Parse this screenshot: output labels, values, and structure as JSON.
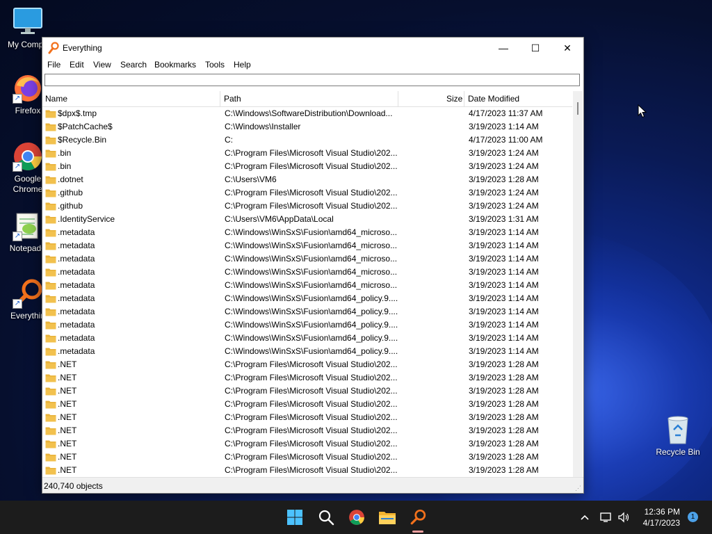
{
  "desktop": {
    "icons": [
      {
        "label": "My Compu",
        "icon": "monitor-icon"
      },
      {
        "label": "Firefox",
        "icon": "firefox-icon"
      },
      {
        "label": "Google Chrome",
        "icon": "chrome-icon"
      },
      {
        "label": "Notepad+",
        "icon": "notepad-plus-plus-icon"
      },
      {
        "label": "Everythin",
        "icon": "everything-icon"
      },
      {
        "label": "Recycle Bin",
        "icon": "recycle-bin-icon"
      }
    ]
  },
  "window": {
    "title": "Everything",
    "controls": {
      "minimize": "—",
      "maximize": "☐",
      "close": "✕"
    },
    "menu": [
      "File",
      "Edit",
      "View",
      "Search",
      "Bookmarks",
      "Tools",
      "Help"
    ],
    "search": {
      "value": "",
      "placeholder": ""
    },
    "columns": {
      "name": "Name",
      "path": "Path",
      "size": "Size",
      "date": "Date Modified"
    },
    "rows": [
      {
        "name": "$dpx$.tmp",
        "path": "C:\\Windows\\SoftwareDistribution\\Download...",
        "date": "4/17/2023 11:37 AM"
      },
      {
        "name": "$PatchCache$",
        "path": "C:\\Windows\\Installer",
        "date": "3/19/2023 1:14 AM"
      },
      {
        "name": "$Recycle.Bin",
        "path": "C:",
        "date": "4/17/2023 11:00 AM"
      },
      {
        "name": ".bin",
        "path": "C:\\Program Files\\Microsoft Visual Studio\\202...",
        "date": "3/19/2023 1:24 AM"
      },
      {
        "name": ".bin",
        "path": "C:\\Program Files\\Microsoft Visual Studio\\202...",
        "date": "3/19/2023 1:24 AM"
      },
      {
        "name": ".dotnet",
        "path": "C:\\Users\\VM6",
        "date": "3/19/2023 1:28 AM"
      },
      {
        "name": ".github",
        "path": "C:\\Program Files\\Microsoft Visual Studio\\202...",
        "date": "3/19/2023 1:24 AM"
      },
      {
        "name": ".github",
        "path": "C:\\Program Files\\Microsoft Visual Studio\\202...",
        "date": "3/19/2023 1:24 AM"
      },
      {
        "name": ".IdentityService",
        "path": "C:\\Users\\VM6\\AppData\\Local",
        "date": "3/19/2023 1:31 AM"
      },
      {
        "name": ".metadata",
        "path": "C:\\Windows\\WinSxS\\Fusion\\amd64_microso...",
        "date": "3/19/2023 1:14 AM"
      },
      {
        "name": ".metadata",
        "path": "C:\\Windows\\WinSxS\\Fusion\\amd64_microso...",
        "date": "3/19/2023 1:14 AM"
      },
      {
        "name": ".metadata",
        "path": "C:\\Windows\\WinSxS\\Fusion\\amd64_microso...",
        "date": "3/19/2023 1:14 AM"
      },
      {
        "name": ".metadata",
        "path": "C:\\Windows\\WinSxS\\Fusion\\amd64_microso...",
        "date": "3/19/2023 1:14 AM"
      },
      {
        "name": ".metadata",
        "path": "C:\\Windows\\WinSxS\\Fusion\\amd64_microso...",
        "date": "3/19/2023 1:14 AM"
      },
      {
        "name": ".metadata",
        "path": "C:\\Windows\\WinSxS\\Fusion\\amd64_policy.9....",
        "date": "3/19/2023 1:14 AM"
      },
      {
        "name": ".metadata",
        "path": "C:\\Windows\\WinSxS\\Fusion\\amd64_policy.9....",
        "date": "3/19/2023 1:14 AM"
      },
      {
        "name": ".metadata",
        "path": "C:\\Windows\\WinSxS\\Fusion\\amd64_policy.9....",
        "date": "3/19/2023 1:14 AM"
      },
      {
        "name": ".metadata",
        "path": "C:\\Windows\\WinSxS\\Fusion\\amd64_policy.9....",
        "date": "3/19/2023 1:14 AM"
      },
      {
        "name": ".metadata",
        "path": "C:\\Windows\\WinSxS\\Fusion\\amd64_policy.9....",
        "date": "3/19/2023 1:14 AM"
      },
      {
        "name": ".NET",
        "path": "C:\\Program Files\\Microsoft Visual Studio\\202...",
        "date": "3/19/2023 1:28 AM"
      },
      {
        "name": ".NET",
        "path": "C:\\Program Files\\Microsoft Visual Studio\\202...",
        "date": "3/19/2023 1:28 AM"
      },
      {
        "name": ".NET",
        "path": "C:\\Program Files\\Microsoft Visual Studio\\202...",
        "date": "3/19/2023 1:28 AM"
      },
      {
        "name": ".NET",
        "path": "C:\\Program Files\\Microsoft Visual Studio\\202...",
        "date": "3/19/2023 1:28 AM"
      },
      {
        "name": ".NET",
        "path": "C:\\Program Files\\Microsoft Visual Studio\\202...",
        "date": "3/19/2023 1:28 AM"
      },
      {
        "name": ".NET",
        "path": "C:\\Program Files\\Microsoft Visual Studio\\202...",
        "date": "3/19/2023 1:28 AM"
      },
      {
        "name": ".NET",
        "path": "C:\\Program Files\\Microsoft Visual Studio\\202...",
        "date": "3/19/2023 1:28 AM"
      },
      {
        "name": ".NET",
        "path": "C:\\Program Files\\Microsoft Visual Studio\\202...",
        "date": "3/19/2023 1:28 AM"
      },
      {
        "name": ".NET",
        "path": "C:\\Program Files\\Microsoft Visual Studio\\202...",
        "date": "3/19/2023 1:28 AM"
      }
    ],
    "status": "240,740 objects"
  },
  "taskbar": {
    "apps": [
      "start-icon",
      "search-icon",
      "chrome-icon",
      "file-explorer-icon",
      "everything-icon"
    ],
    "tray": [
      "chevron-up-icon",
      "network-icon",
      "volume-icon"
    ],
    "clock": {
      "time": "12:36 PM",
      "date": "4/17/2023"
    },
    "notifications": "1"
  },
  "colors": {
    "folder": "#f2c14e",
    "taskbar": "#1c1c1c",
    "accent": "#f2711c"
  }
}
